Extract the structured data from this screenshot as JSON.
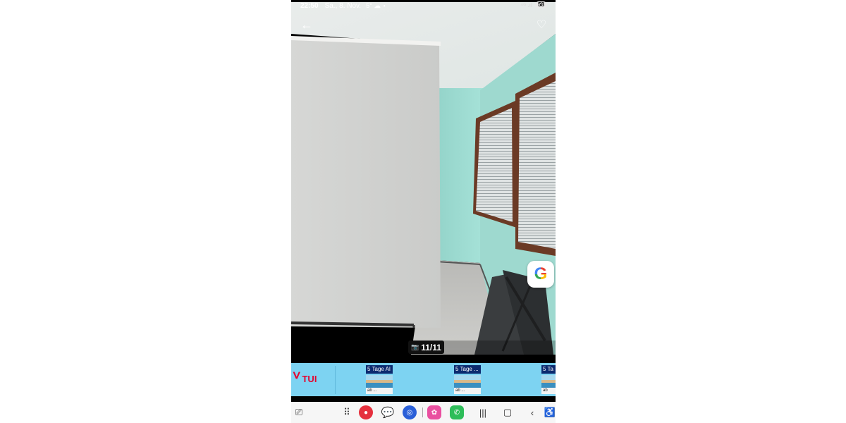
{
  "status_bar": {
    "time": "22:50",
    "date": "Sa., 8. Nov.",
    "temperature": "5°",
    "signal": "⁴ᴳ .ıl",
    "battery": "58"
  },
  "viewer": {
    "photo_counter": "11/11"
  },
  "ad": {
    "brand": "TUI",
    "tiles": [
      {
        "label": "5 Tage Al",
        "sub": "ab ..."
      },
      {
        "label": "5 Tage ...",
        "sub": "ab ..."
      },
      {
        "label": "5 Ta",
        "sub": "ab"
      }
    ]
  },
  "icons": {
    "back": "arrow-left-icon",
    "favorite": "heart-icon",
    "google_lens": "google-icon",
    "camera": "camera-icon"
  },
  "colors": {
    "ad_background": "#7dd3f2",
    "tui_red": "#e4032e",
    "wall_mint": "#a6e2d8"
  }
}
